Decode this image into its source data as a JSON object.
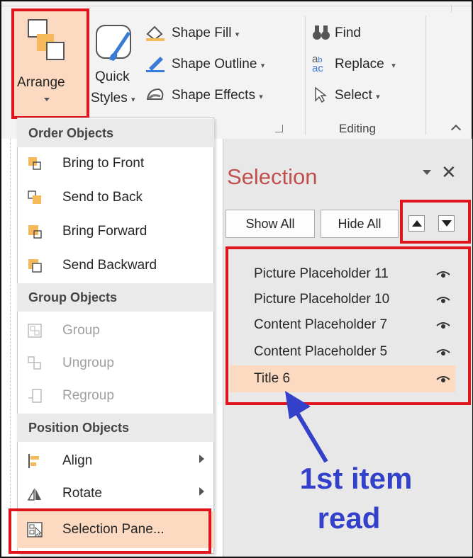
{
  "ribbon": {
    "arrange_label": "Arrange",
    "quick_styles_line1": "Quick",
    "quick_styles_line2": "Styles",
    "shape_fill": "Shape Fill",
    "shape_outline": "Shape Outline",
    "shape_effects": "Shape Effects",
    "find": "Find",
    "replace": "Replace",
    "select": "Select",
    "editing_group": "Editing"
  },
  "menu": {
    "sections": [
      {
        "header": "Order Objects",
        "items": [
          {
            "label": "Bring to Front",
            "icon": "bring-to-front-icon",
            "enabled": true
          },
          {
            "label": "Send to Back",
            "icon": "send-to-back-icon",
            "enabled": true
          },
          {
            "label": "Bring Forward",
            "icon": "bring-forward-icon",
            "enabled": true
          },
          {
            "label": "Send Backward",
            "icon": "send-backward-icon",
            "enabled": true
          }
        ]
      },
      {
        "header": "Group Objects",
        "items": [
          {
            "label": "Group",
            "icon": "group-icon",
            "enabled": false
          },
          {
            "label": "Ungroup",
            "icon": "ungroup-icon",
            "enabled": false
          },
          {
            "label": "Regroup",
            "icon": "regroup-icon",
            "enabled": false
          }
        ]
      },
      {
        "header": "Position Objects",
        "items": [
          {
            "label": "Align",
            "icon": "align-icon",
            "enabled": true,
            "submenu": true
          },
          {
            "label": "Rotate",
            "icon": "rotate-icon",
            "enabled": true,
            "submenu": true
          },
          {
            "label": "Selection Pane...",
            "icon": "selection-pane-icon",
            "enabled": true,
            "highlighted": true
          }
        ]
      }
    ]
  },
  "pane": {
    "title": "Selection",
    "show_all": "Show All",
    "hide_all": "Hide All",
    "items": [
      {
        "label": "Picture Placeholder 11",
        "selected": false
      },
      {
        "label": "Picture Placeholder 10",
        "selected": false
      },
      {
        "label": "Content Placeholder 7",
        "selected": false
      },
      {
        "label": "Content Placeholder 5",
        "selected": false
      },
      {
        "label": "Title 6",
        "selected": true
      }
    ]
  },
  "annotation": {
    "line1": "1st item",
    "line2": "read"
  },
  "colors": {
    "highlight": "#fcd9c1",
    "callout_red": "#e0141e",
    "annotation_blue": "#3340c9",
    "pane_title": "#c0504d"
  }
}
